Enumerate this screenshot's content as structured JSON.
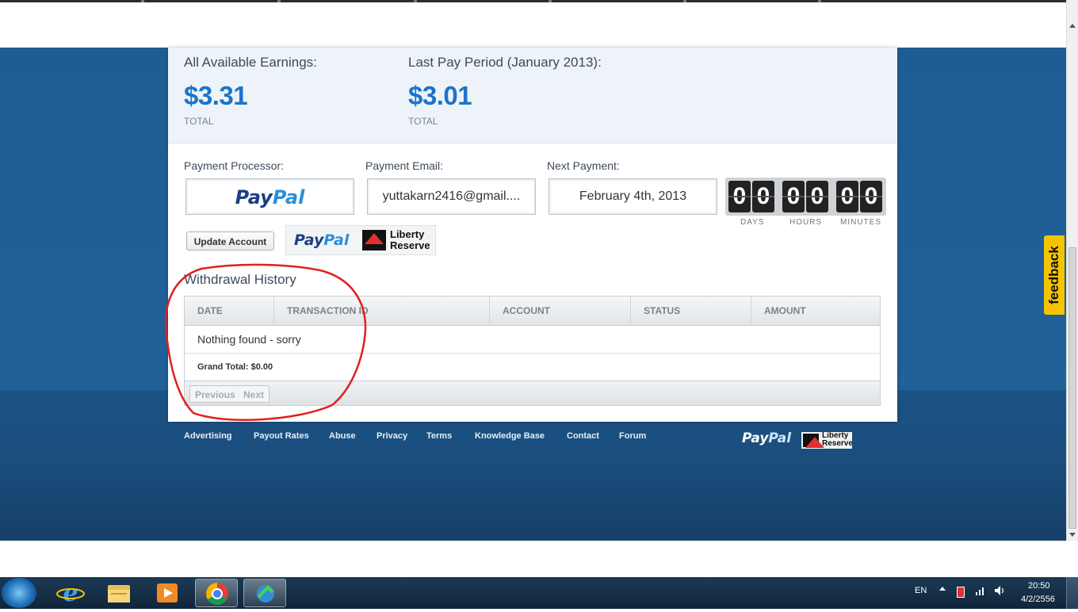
{
  "earnings": {
    "available_label": "All Available Earnings:",
    "available_amount": "$3.31",
    "available_total_label": "TOTAL",
    "last_period_label": "Last Pay Period (January 2013):",
    "last_period_amount": "$3.01",
    "last_period_total_label": "TOTAL"
  },
  "payment": {
    "processor_label": "Payment Processor:",
    "processor_logo_a": "Pay",
    "processor_logo_b": "Pal",
    "email_label": "Payment Email:",
    "email_value": "yuttakarn2416@gmail....",
    "next_label": "Next Payment:",
    "next_value": "February 4th, 2013",
    "countdown": {
      "digits": [
        "0",
        "0",
        "0",
        "0",
        "0",
        "0"
      ],
      "days_label": "DAYS",
      "hours_label": "HOURS",
      "minutes_label": "MINUTES"
    },
    "update_button": "Update Account",
    "logo_paypal_a": "Pay",
    "logo_paypal_b": "Pal",
    "logo_liberty_1": "Liberty",
    "logo_liberty_2": "Reserve"
  },
  "withdrawal": {
    "title": "Withdrawal History",
    "columns": [
      "DATE",
      "TRANSACTION ID",
      "ACCOUNT",
      "STATUS",
      "AMOUNT"
    ],
    "empty_message": "Nothing found - sorry",
    "grand_total": "Grand Total: $0.00",
    "previous": "Previous",
    "next": "Next"
  },
  "footer": {
    "links": [
      "Advertising",
      "Payout Rates",
      "Abuse",
      "Privacy",
      "Terms",
      "Knowledge Base",
      "Contact",
      "Forum"
    ],
    "logo_paypal_a": "Pay",
    "logo_paypal_b": "Pal",
    "logo_liberty_1": "Liberty",
    "logo_liberty_2": "Reserve"
  },
  "feedback_tab": "feedback",
  "taskbar": {
    "apps": [
      "ie-icon",
      "explorer-icon",
      "media-player-icon",
      "chrome-icon",
      "network-app-icon"
    ],
    "language": "EN",
    "time": "20:50",
    "date": "4/2/2556"
  },
  "colors": {
    "accent_blue": "#1a74c9",
    "page_background": "#1e5d93",
    "feedback_yellow": "#f5c400",
    "annotation_red": "#e02020"
  }
}
